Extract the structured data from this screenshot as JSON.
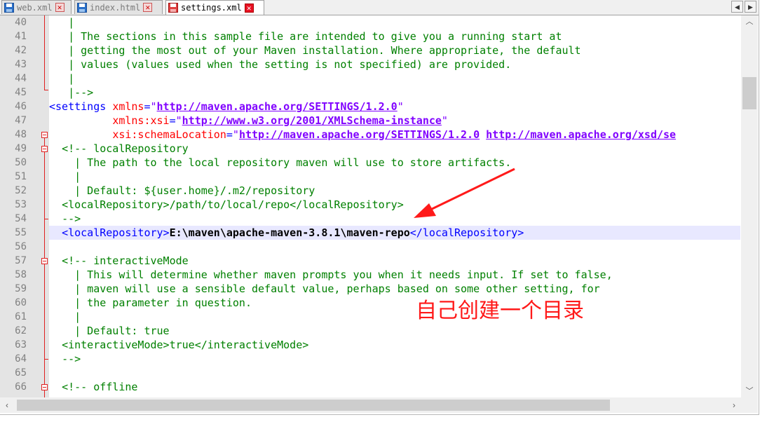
{
  "tabs": [
    {
      "name": "web.xml",
      "icon": "save-disk-icon",
      "active": false
    },
    {
      "name": "index.html",
      "icon": "save-disk-icon",
      "active": false
    },
    {
      "name": "settings.xml",
      "icon": "save-disk-red-icon",
      "active": true
    }
  ],
  "tab_close_glyph": "✕",
  "nav": {
    "left": "◀",
    "right": "▶"
  },
  "line_numbers": [
    "40",
    "41",
    "42",
    "43",
    "44",
    "45",
    "46",
    "47",
    "48",
    "49",
    "50",
    "51",
    "52",
    "53",
    "54",
    "55",
    "56",
    "57",
    "58",
    "59",
    "60",
    "61",
    "62",
    "63",
    "64",
    "65",
    "66"
  ],
  "highlighted_line": "55",
  "code": {
    "l40": " |",
    "l41": " | The sections in this sample file are intended to give you a running start at",
    "l42": " | getting the most out of your Maven installation. Where appropriate, the default",
    "l43": " | values (values used when the setting is not specified) are provided.",
    "l44": " |",
    "l45": " |-->",
    "l46_tag": "<settings",
    "l46_attr": "xmlns",
    "l46_eq": "=",
    "l46_q1": "\"",
    "l46_val": "http://maven.apache.org/SETTINGS/1.2.0",
    "l46_q2": "\"",
    "l47_attr": "xmlns:xsi",
    "l47_val": "http://www.w3.org/2001/XMLSchema-instance",
    "l48_attr": "xsi:schemaLocation",
    "l48_val1": "http://maven.apache.org/SETTINGS/1.2.0",
    "l48_val2": "http://maven.apache.org/xsd/se",
    "l49": "<!-- localRepository",
    "l50": " | The path to the local repository maven will use to store artifacts.",
    "l51": " |",
    "l52": " | Default: ${user.home}/.m2/repository",
    "l53": "<localRepository>/path/to/local/repo</localRepository>",
    "l54": "-->",
    "l55_open": "<localRepository>",
    "l55_val": "E:\\maven\\apache-maven-3.8.1\\maven-repo",
    "l55_close": "</localRepository>",
    "l57": "<!-- interactiveMode",
    "l58": " | This will determine whether maven prompts you when it needs input. If set to false,",
    "l59": " | maven will use a sensible default value, perhaps based on some other setting, for",
    "l60": " | the parameter in question.",
    "l61": " |",
    "l62": " | Default: true",
    "l63": "<interactiveMode>true</interactiveMode>",
    "l64": "-->",
    "l66": "<!-- offline"
  },
  "annotation_text": "自己创建一个目录",
  "colors": {
    "tag": "#0000ff",
    "attr": "#ff0000",
    "string": "#8000ff",
    "comment": "#008000",
    "annotation": "#ff1a1a",
    "fold": "#e02020"
  }
}
